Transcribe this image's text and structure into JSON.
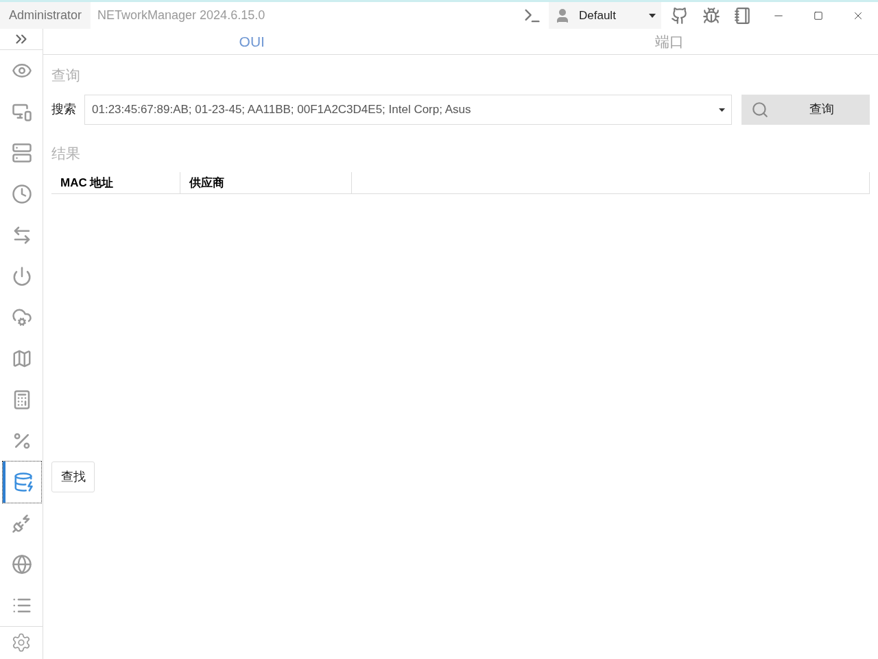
{
  "title_bar": {
    "user": "Administrator",
    "title": "NETworkManager 2024.6.15.0",
    "profile": "Default"
  },
  "sidebar": {
    "items": [
      {
        "selected": false
      },
      {
        "selected": false
      },
      {
        "selected": false
      },
      {
        "selected": false
      },
      {
        "selected": false
      },
      {
        "selected": false
      },
      {
        "selected": false
      },
      {
        "selected": false
      },
      {
        "selected": false
      },
      {
        "selected": false
      },
      {
        "selected": true
      },
      {
        "selected": false
      },
      {
        "selected": false
      },
      {
        "selected": false
      }
    ]
  },
  "tabs": [
    {
      "label": "OUI",
      "selected": true
    },
    {
      "label": "端口",
      "selected": false
    }
  ],
  "query": {
    "heading": "查询",
    "search_label": "搜索",
    "search": {
      "placeholder": "01:23:45:67:89:AB; 01-23-45; AA11BB; 00F1A2C3D4E5; Intel Corp; Asus"
    },
    "button": "查询"
  },
  "results": {
    "heading": "结果",
    "columns": [
      "MAC 地址",
      "供应商"
    ]
  },
  "find_button": "查找"
}
